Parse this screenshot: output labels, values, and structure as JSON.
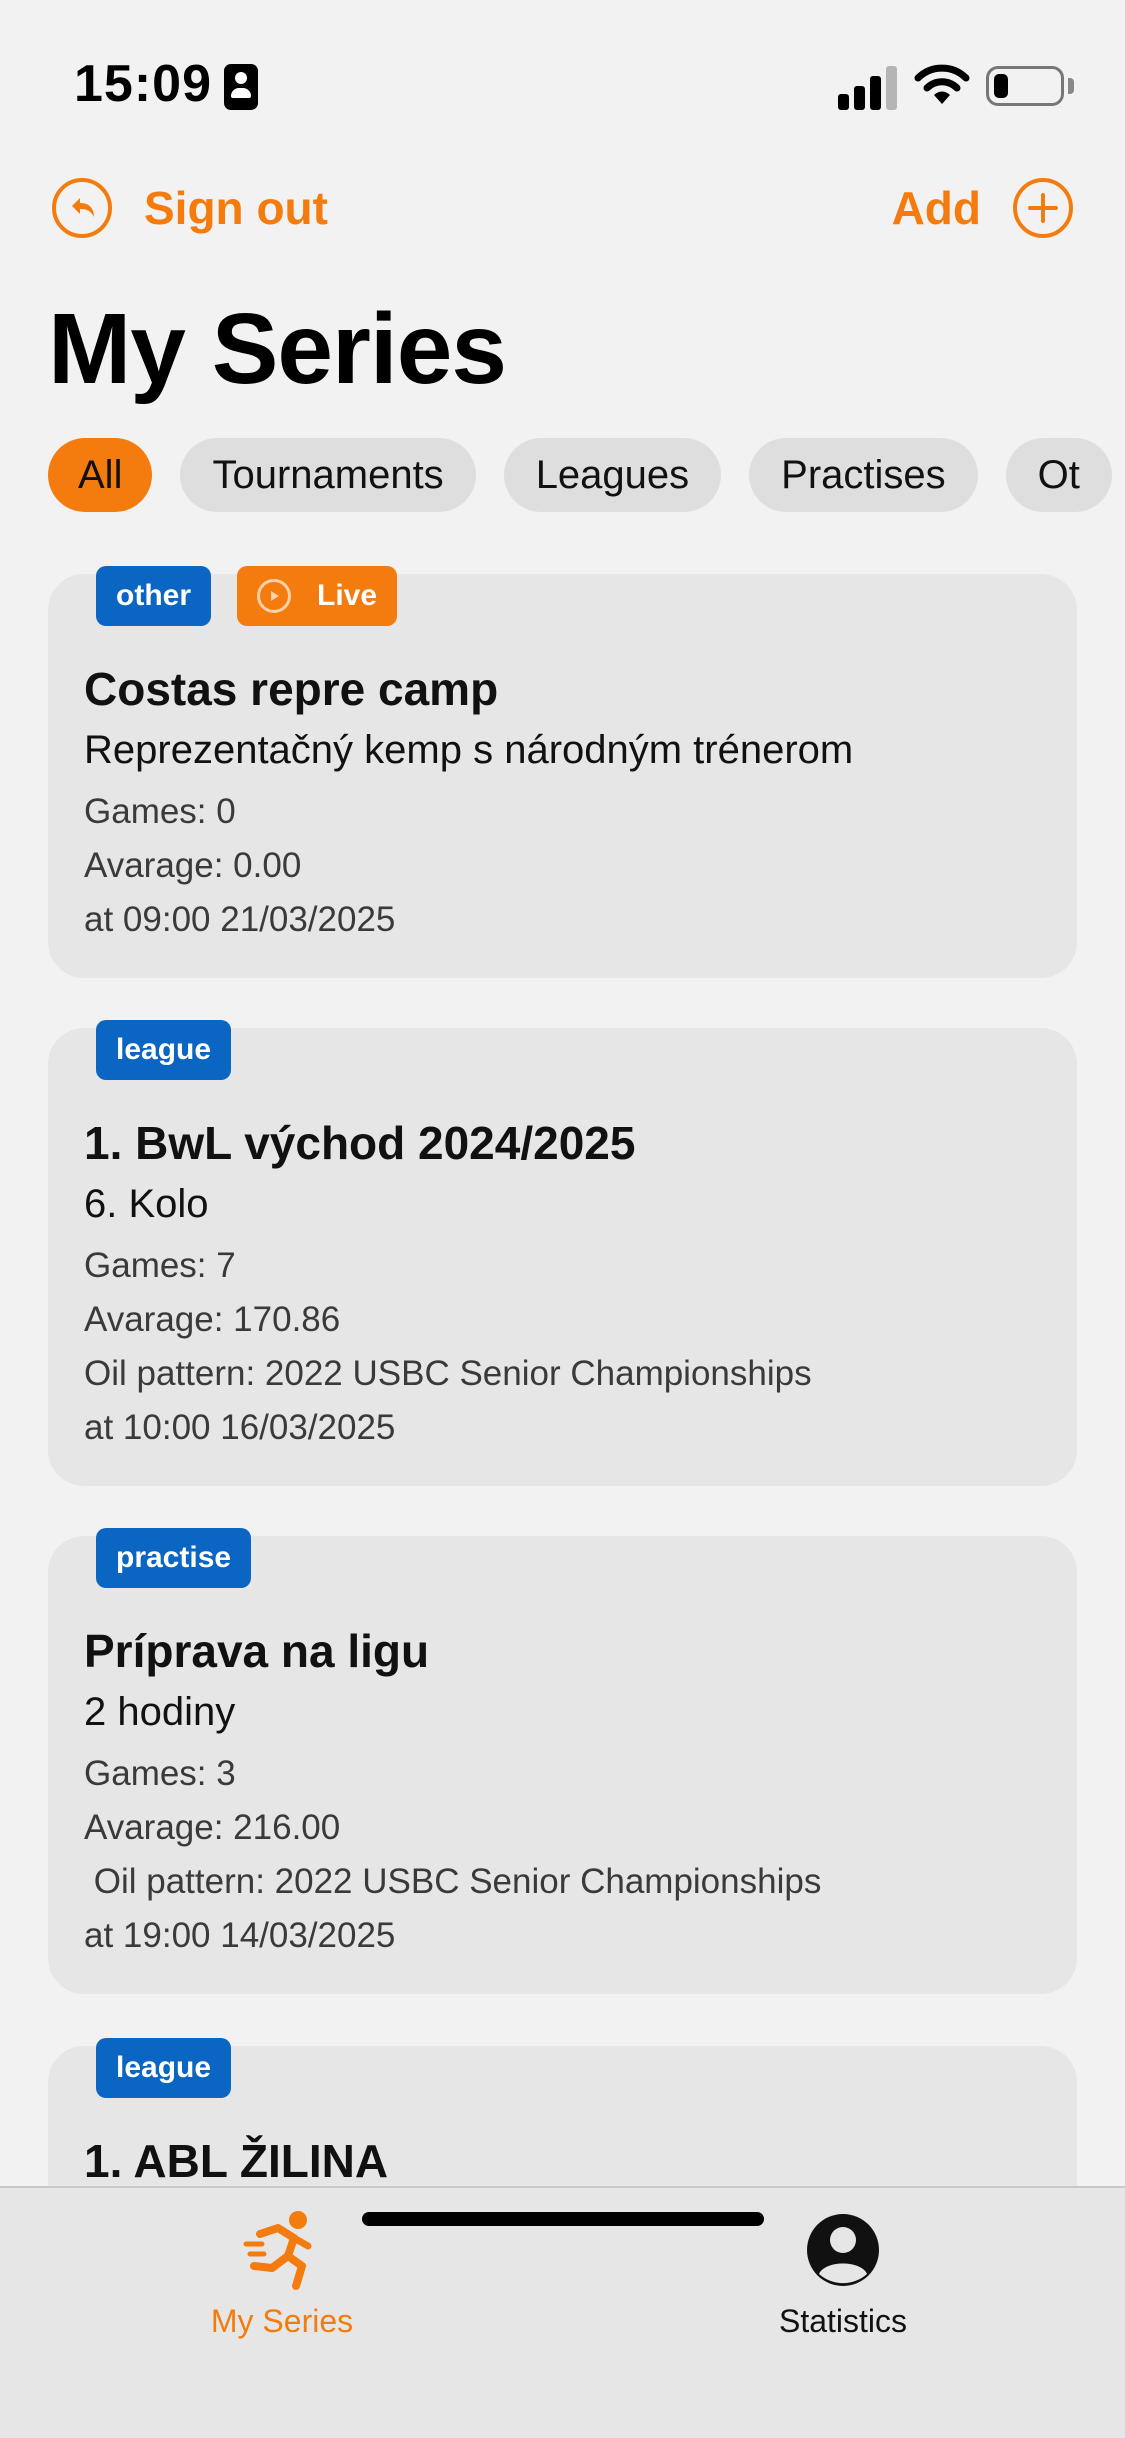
{
  "status_bar": {
    "time": "15:09",
    "icons": [
      "id-card-icon",
      "cellular-signal-icon",
      "wifi-icon",
      "battery-icon"
    ]
  },
  "nav": {
    "sign_out_label": "Sign out",
    "add_label": "Add",
    "sign_out_icon": "back-arrow-circle-icon",
    "add_icon": "plus-circle-icon"
  },
  "page": {
    "title": "My Series"
  },
  "filters": {
    "chips": [
      "All",
      "Tournaments",
      "Leagues",
      "Practises",
      "Ot"
    ],
    "active": "All"
  },
  "series": [
    {
      "badge": "other",
      "live_label": "Live",
      "title": "Costas repre camp",
      "subtitle": "Reprezentačný kemp s národným trénerom",
      "games": "Games: 0",
      "average": "Avarage: 0.00",
      "datetime": "at 09:00 21/03/2025"
    },
    {
      "badge": "league",
      "title": "1. BwL východ 2024/2025",
      "subtitle": "6. Kolo",
      "games": "Games: 7",
      "average": "Avarage: 170.86",
      "oil_pattern": "Oil pattern: 2022 USBC Senior Championships",
      "datetime": "at 10:00 16/03/2025"
    },
    {
      "badge": "practise",
      "title": "Príprava na ligu",
      "subtitle": "2 hodiny",
      "games": "Games: 3",
      "average": "Avarage: 216.00",
      "oil_pattern": " Oil pattern: 2022 USBC Senior Championships",
      "datetime": "at 19:00 14/03/2025"
    },
    {
      "badge": "league",
      "title": "1. ABL ŽILINA"
    }
  ],
  "tabbar": {
    "tabs": [
      {
        "label": "My Series",
        "icon": "running-person-icon",
        "active": true
      },
      {
        "label": "Statistics",
        "icon": "person-circle-icon",
        "active": false
      }
    ]
  },
  "colors": {
    "accent": "#f47c0f",
    "badge_blue": "#0a66c2",
    "background": "#f2f2f2",
    "card": "#e6e6e6"
  }
}
